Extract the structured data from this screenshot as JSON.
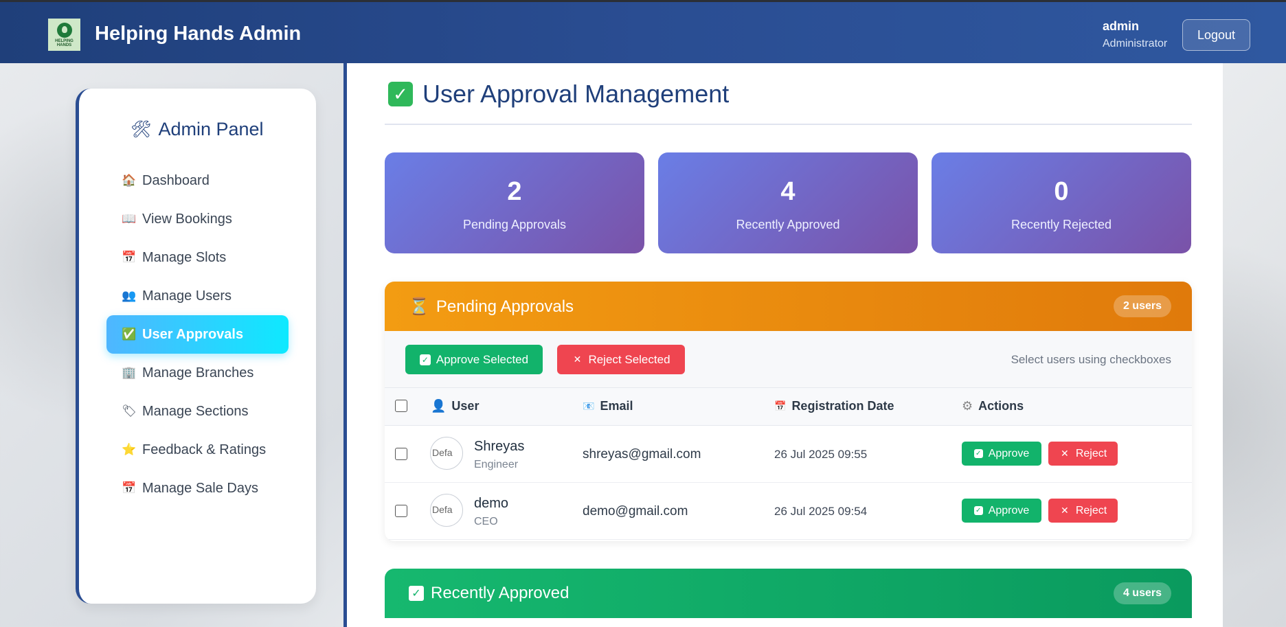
{
  "header": {
    "logo_text": "HELPING HANDS",
    "app_title": "Helping Hands Admin",
    "user_name": "admin",
    "user_role": "Administrator",
    "logout_label": "Logout",
    "colors": {
      "header_start": "#1f3f7a",
      "header_end": "#2f58a0"
    }
  },
  "sidebar": {
    "title": "Admin Panel",
    "title_icon": "tools-icon",
    "items": [
      {
        "label": "Dashboard",
        "icon": "house-icon",
        "glyph": "🏠",
        "active": false
      },
      {
        "label": "View Bookings",
        "icon": "book-icon",
        "glyph": "📖",
        "active": false
      },
      {
        "label": "Manage Slots",
        "icon": "calendar-icon",
        "glyph": "📅",
        "active": false
      },
      {
        "label": "Manage Users",
        "icon": "users-icon",
        "glyph": "👥",
        "active": false
      },
      {
        "label": "User Approvals",
        "icon": "check-box-icon",
        "glyph": "✅",
        "active": true
      },
      {
        "label": "Manage Branches",
        "icon": "office-building-icon",
        "glyph": "🏢",
        "active": false
      },
      {
        "label": "Manage Sections",
        "icon": "tag-icon",
        "glyph": "🏷",
        "active": false
      },
      {
        "label": "Feedback & Ratings",
        "icon": "star-icon",
        "glyph": "⭐",
        "active": false
      },
      {
        "label": "Manage Sale Days",
        "icon": "calendar-icon",
        "glyph": "📅",
        "active": false
      }
    ]
  },
  "main": {
    "page_title": "User Approval Management",
    "stats": [
      {
        "value": "2",
        "label": "Pending Approvals"
      },
      {
        "value": "4",
        "label": "Recently Approved"
      },
      {
        "value": "0",
        "label": "Recently Rejected"
      }
    ],
    "pending": {
      "title": "Pending Approvals",
      "count": "2 users",
      "approve_selected": "Approve Selected",
      "reject_selected": "Reject Selected",
      "hint": "Select users using checkboxes",
      "columns": [
        "User",
        "Email",
        "Registration Date",
        "Actions"
      ],
      "rows": [
        {
          "name": "Shreyas",
          "role": "Engineer",
          "avatar_alt": "Defa",
          "email": "shreyas@gmail.com",
          "date": "26 Jul 2025 09:55",
          "approve": "Approve",
          "reject": "Reject"
        },
        {
          "name": "demo",
          "role": "CEO",
          "avatar_alt": "Defa",
          "email": "demo@gmail.com",
          "date": "26 Jul 2025 09:54",
          "approve": "Approve",
          "reject": "Reject"
        }
      ]
    },
    "approved": {
      "title": "Recently Approved",
      "count": "4 users"
    },
    "colors": {
      "stat_gradient_start": "#6a7ee6",
      "stat_gradient_end": "#7a52a8",
      "pending_header": "#f39c12",
      "approved_header": "#16b86f",
      "approve_button": "#12b36b",
      "reject_button": "#ef4550",
      "active_nav": "#0ee9ff"
    }
  }
}
